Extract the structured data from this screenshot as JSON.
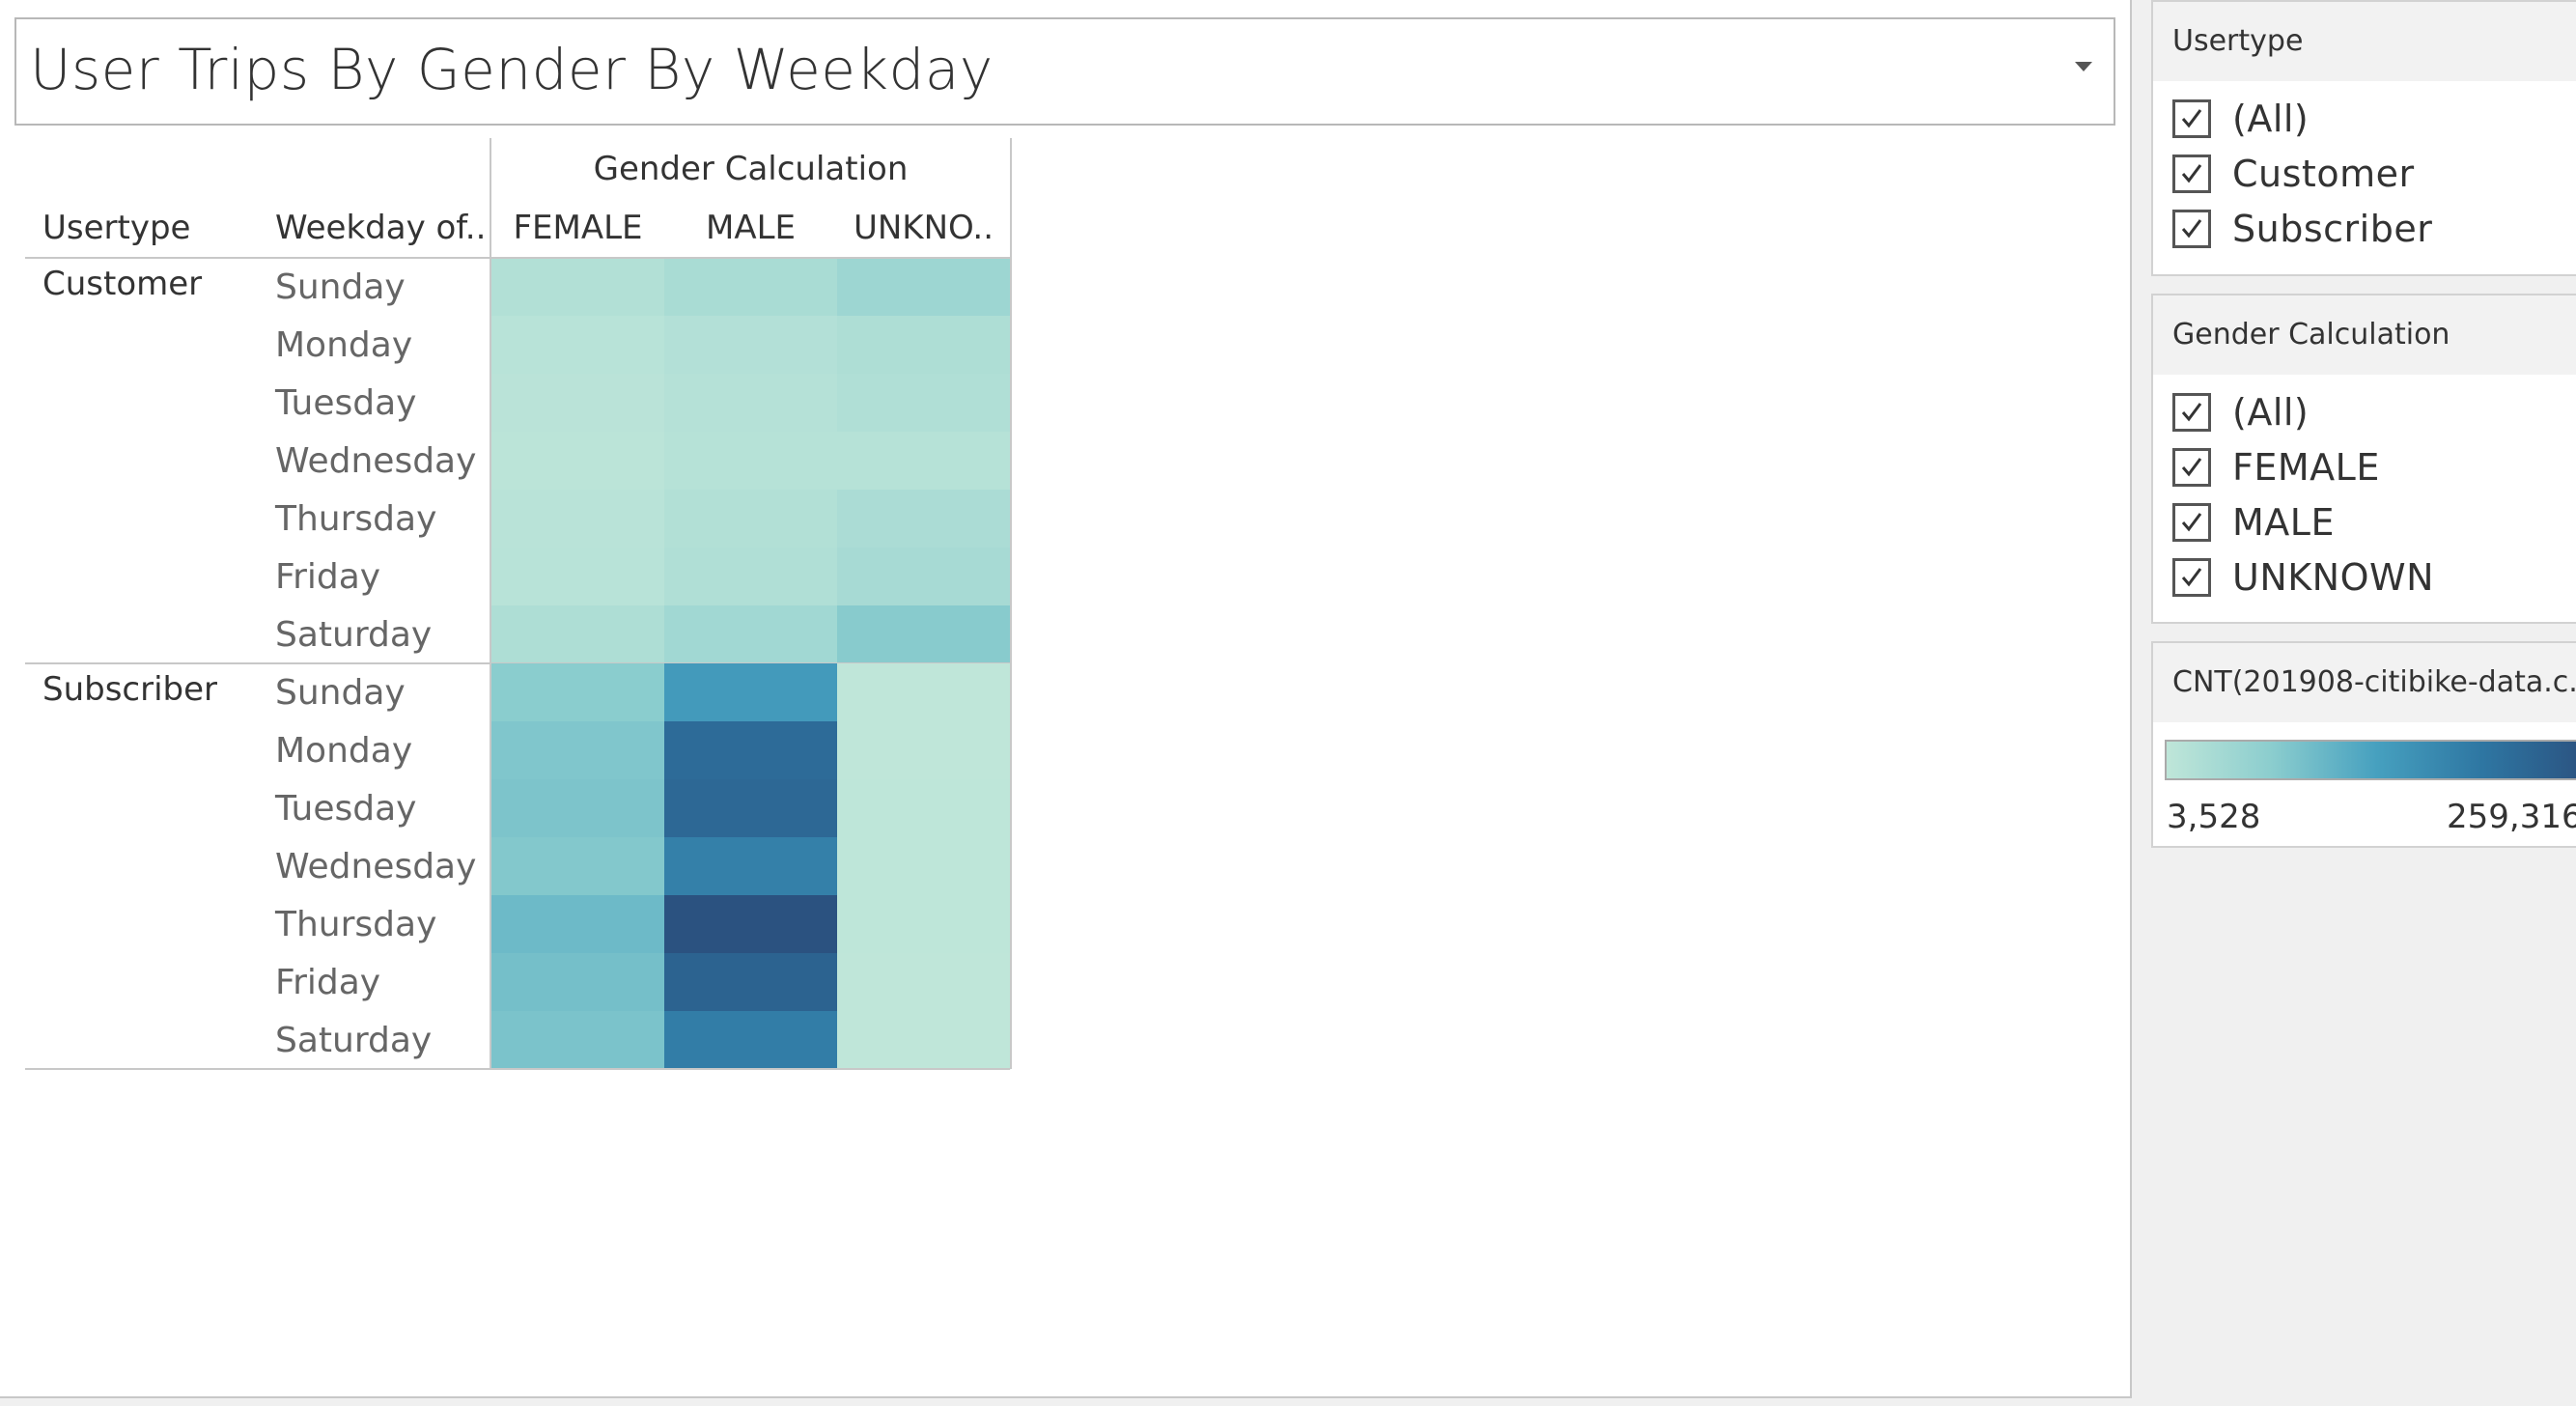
{
  "title": "User Trips By Gender By Weekday",
  "chart_data": {
    "type": "heatmap",
    "column_group_label": "Gender Calculation",
    "row_headers": [
      "Usertype",
      "Weekday of.."
    ],
    "columns": [
      "FEMALE",
      "MALE",
      "UNKNO.."
    ],
    "row_groups": [
      {
        "name": "Customer",
        "rows": [
          "Sunday",
          "Monday",
          "Tuesday",
          "Wednesday",
          "Thursday",
          "Friday",
          "Saturday"
        ],
        "values": [
          [
            20000,
            30000,
            45000
          ],
          [
            12000,
            18000,
            25000
          ],
          [
            10000,
            16000,
            22000
          ],
          [
            9000,
            14000,
            15000
          ],
          [
            11000,
            20000,
            28000
          ],
          [
            12000,
            22000,
            33000
          ],
          [
            25000,
            40000,
            70000
          ]
        ]
      },
      {
        "name": "Subscriber",
        "rows": [
          "Sunday",
          "Monday",
          "Tuesday",
          "Wednesday",
          "Thursday",
          "Friday",
          "Saturday"
        ],
        "values": [
          [
            68000,
            140000,
            4000
          ],
          [
            78000,
            215000,
            4000
          ],
          [
            80000,
            220000,
            4500
          ],
          [
            75000,
            180000,
            4500
          ],
          [
            95000,
            259316,
            4200
          ],
          [
            88000,
            230000,
            3600
          ],
          [
            82000,
            185000,
            3528
          ]
        ]
      }
    ],
    "color_scale": {
      "min": 3528,
      "max": 259316,
      "colors": [
        "#bfe6d9",
        "#8bcdce",
        "#46a0bf",
        "#2e76a2",
        "#2b5280"
      ]
    }
  },
  "filters": {
    "usertype": {
      "title": "Usertype",
      "items": [
        {
          "label": "(All)",
          "checked": true
        },
        {
          "label": "Customer",
          "checked": true
        },
        {
          "label": "Subscriber",
          "checked": true
        }
      ]
    },
    "gender": {
      "title": "Gender Calculation",
      "items": [
        {
          "label": "(All)",
          "checked": true
        },
        {
          "label": "FEMALE",
          "checked": true
        },
        {
          "label": "MALE",
          "checked": true
        },
        {
          "label": "UNKNOWN",
          "checked": true
        }
      ]
    }
  },
  "legend": {
    "title": "CNT(201908-citibike-data.c...",
    "min_label": "3,528",
    "max_label": "259,316"
  }
}
